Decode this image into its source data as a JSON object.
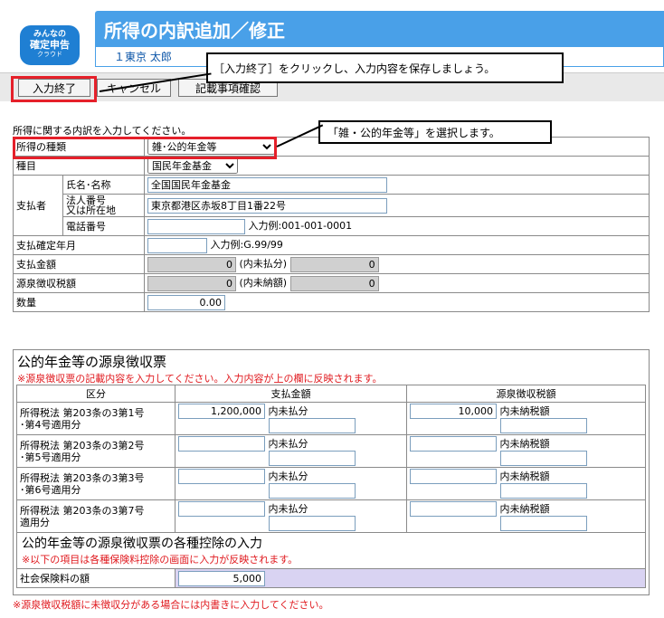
{
  "logo": {
    "line1": "みんなの",
    "line2": "確定申告",
    "line3": "クラウド"
  },
  "header": {
    "title": "所得の内訳追加／修正",
    "user": "１東京 太郎"
  },
  "callouts": {
    "finish": "［入力終了］をクリックし、入力内容を保存しましょう。",
    "category": "「雑・公的年金等」を選択します。"
  },
  "toolbar": {
    "finish": "入力終了",
    "cancel": "キャンセル",
    "check": "記載事項確認"
  },
  "intro": "所得に関する内訳を入力してください。",
  "form": {
    "category_label": "所得の種類",
    "category_value": "雑･公的年金等",
    "item_label": "種目",
    "item_value": "国民年金基金",
    "payer_label": "支払者",
    "name_label": "氏名･名称",
    "name_value": "全国国民年金基金",
    "corp_label1": "法人番号",
    "corp_label2": "又は所在地",
    "corp_value": "東京都港区赤坂8丁目1番22号",
    "phone_label": "電話番号",
    "phone_value": "",
    "phone_example": "入力例:001-001-0001",
    "date_label": "支払確定年月",
    "date_value": "",
    "date_example": "入力例:G.99/99",
    "amount_label": "支払金額",
    "amount_value": "0",
    "amount_unpaid_label": "(内未払分)",
    "amount_unpaid_value": "0",
    "tax_label": "源泉徴収税額",
    "tax_value": "0",
    "tax_unpaid_label": "(内未納額)",
    "tax_unpaid_value": "0",
    "qty_label": "数量",
    "qty_value": "0.00"
  },
  "pension": {
    "title": "公的年金等の源泉徴収票",
    "note": "※源泉徴収票の記載内容を入力してください。入力内容が上の欄に反映されます。",
    "headers": [
      "区分",
      "支払金額",
      "源泉徴収税額"
    ],
    "rows": [
      {
        "l1": "所得税法 第203条の3第1号",
        "l2": "･第4号適用分",
        "pay": "1,200,000",
        "pay_sub": "内未払分",
        "tax": "10,000",
        "tax_sub": "内未納税額"
      },
      {
        "l1": "所得税法 第203条の3第2号",
        "l2": "･第5号適用分",
        "pay": "",
        "pay_sub": "内未払分",
        "tax": "",
        "tax_sub": "内未納税額"
      },
      {
        "l1": "所得税法 第203条の3第3号",
        "l2": "･第6号適用分",
        "pay": "",
        "pay_sub": "内未払分",
        "tax": "",
        "tax_sub": "内未納税額"
      },
      {
        "l1": "所得税法 第203条の3第7号",
        "l2": "適用分",
        "pay": "",
        "pay_sub": "内未払分",
        "tax": "",
        "tax_sub": "内未納税額"
      }
    ],
    "deduct_title": "公的年金等の源泉徴収票の各種控除の入力",
    "deduct_note": "※以下の項目は各種保険料控除の画面に入力が反映されます。",
    "social_label": "社会保険料の額",
    "social_value": "5,000"
  },
  "bottom_note": "※源泉徴収税額に未徴収分がある場合には内書きに入力してください。"
}
